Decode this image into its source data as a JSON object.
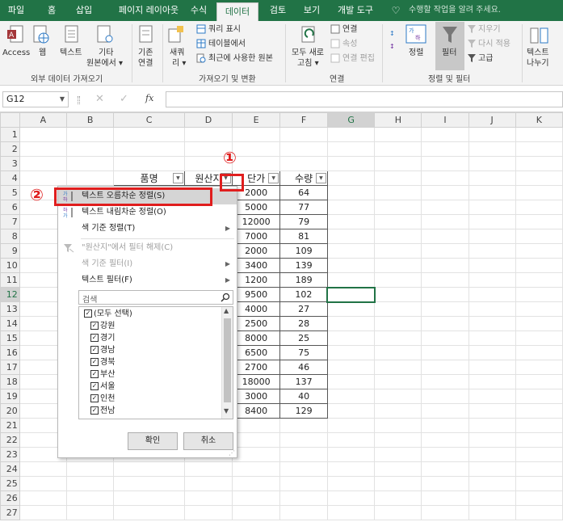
{
  "tabs": [
    "파일",
    "홈",
    "삽입",
    "페이지 레이아웃",
    "수식",
    "데이터",
    "검토",
    "보기",
    "개발 도구"
  ],
  "tell_me": "수행할 작업을 알려 주세요.",
  "ribbon": {
    "access": "Access",
    "web": "웹",
    "text": "텍스트",
    "other_1": "기타",
    "other_2": "원본에서 ▾",
    "existing_1": "기존",
    "existing_2": "연결",
    "newquery_1": "새쿼",
    "newquery_2": "리 ▾",
    "show_queries": "쿼리 표시",
    "from_table": "테이블에서",
    "recent_sources": "최근에 사용한 원본",
    "refresh_1": "모두 새로",
    "refresh_2": "고침 ▾",
    "connections": "연결",
    "properties": "속성",
    "edit_links": "연결 편집",
    "sort": "정렬",
    "filter": "필터",
    "clear": "지우기",
    "reapply": "다시 적용",
    "advanced": "고급",
    "text_to_col_1": "텍스트",
    "text_to_col_2": "나누기",
    "groups": {
      "external": "외부 데이터 가져오기",
      "transform": "가져오기 및 변환",
      "conn": "연결",
      "sortfilter": "정렬 및 필터"
    }
  },
  "formula_bar": {
    "name_box": "G12",
    "fx": "fx",
    "formula": ""
  },
  "columns": [
    "A",
    "B",
    "C",
    "D",
    "E",
    "F",
    "G",
    "H",
    "I",
    "J",
    "K"
  ],
  "rows": [
    "1",
    "2",
    "3",
    "4",
    "5",
    "6",
    "7",
    "8",
    "9",
    "10",
    "11",
    "12",
    "13",
    "14",
    "15",
    "16",
    "17",
    "18",
    "19",
    "20",
    "21",
    "22",
    "23",
    "24",
    "25",
    "26",
    "27"
  ],
  "table": {
    "headers": {
      "item": "품명",
      "origin": "원산지",
      "price": "단가",
      "qty": "수량"
    },
    "price": [
      "2000",
      "5000",
      "12000",
      "7000",
      "2000",
      "3400",
      "1200",
      "9500",
      "4000",
      "2500",
      "8000",
      "6500",
      "2700",
      "18000",
      "3000",
      "8400"
    ],
    "qty": [
      "64",
      "77",
      "79",
      "81",
      "109",
      "139",
      "189",
      "102",
      "27",
      "28",
      "25",
      "75",
      "46",
      "137",
      "40",
      "129"
    ]
  },
  "menu": {
    "sort_asc": "텍스트 오름차순 정렬(S)",
    "sort_desc": "텍스트 내림차순 정렬(O)",
    "sort_color": "색 기준 정렬(T)",
    "clear_filter": "\"원산지\"에서 필터 해제(C)",
    "filter_color": "색 기준 필터(I)",
    "text_filter": "텍스트 필터(F)",
    "search_placeholder": "검색",
    "items": [
      "(모두 선택)",
      "강원",
      "경기",
      "경남",
      "경북",
      "부산",
      "서울",
      "인천",
      "전남"
    ],
    "ok": "확인",
    "cancel": "취소"
  },
  "annotations": {
    "one": "①",
    "two": "②"
  },
  "colors": {
    "excel_green": "#217346",
    "annotation_red": "#e01e1e"
  }
}
